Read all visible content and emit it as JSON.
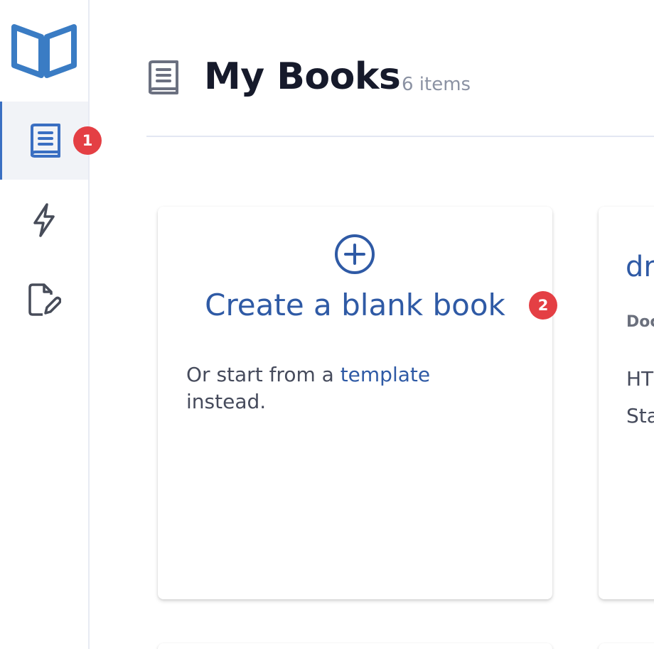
{
  "header": {
    "title": "My Books",
    "count": "6 items"
  },
  "badges": {
    "books_nav": "1",
    "create_card": "2"
  },
  "sidebar": {
    "items": [
      {
        "id": "books",
        "icon": "book-icon",
        "active": true
      },
      {
        "id": "activity",
        "icon": "bolt-icon",
        "active": false
      },
      {
        "id": "drafts",
        "icon": "file-edit-icon",
        "active": false
      }
    ]
  },
  "create_card": {
    "title": "Create a blank book",
    "subtitle_prefix": "Or start from a ",
    "subtitle_link": "template",
    "subtitle_suffix": "instead."
  },
  "next_card": {
    "title": "dr",
    "meta": "Doc",
    "line1": "HT",
    "line2": "Sta"
  },
  "colors": {
    "accent": "#2f5aa5",
    "logo": "#3a7cc4",
    "badge": "#e43f44",
    "text": "#161a2b",
    "muted": "#8b92a3"
  }
}
